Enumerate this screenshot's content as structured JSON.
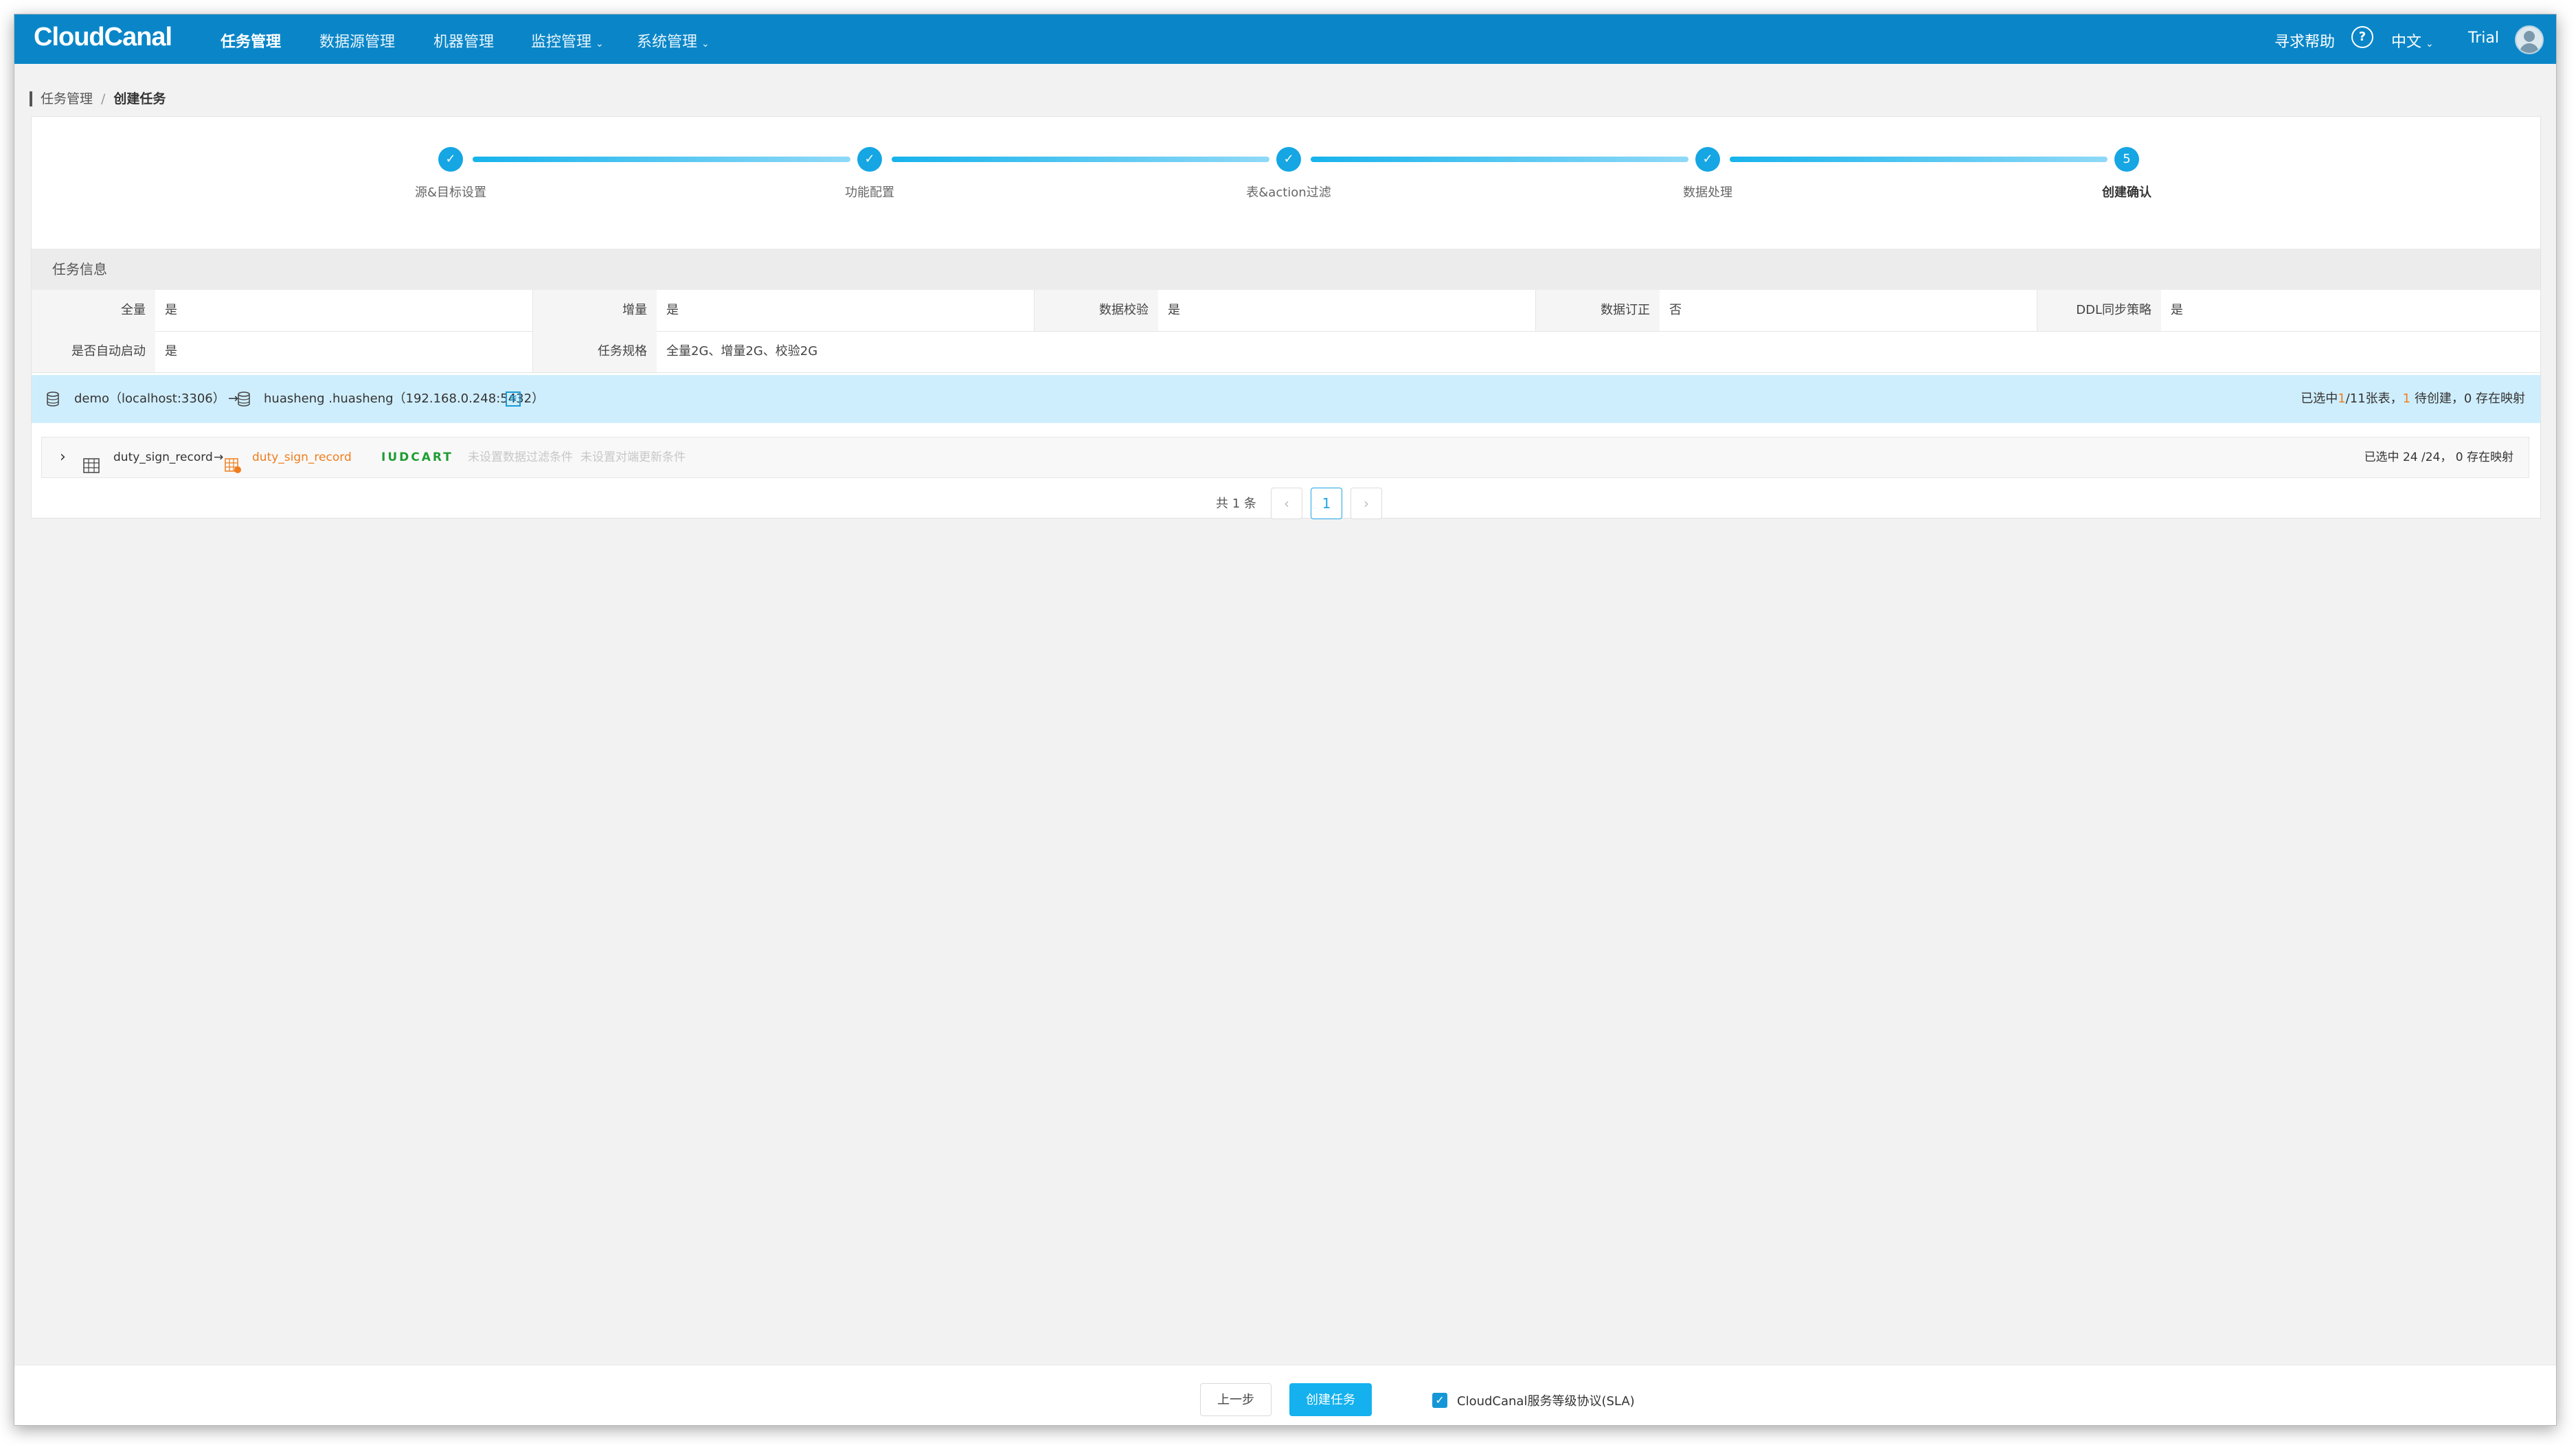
{
  "app": {
    "logo": "CloudCanal"
  },
  "nav": {
    "items": [
      "任务管理",
      "数据源管理",
      "机器管理",
      "监控管理",
      "系统管理"
    ],
    "help": "寻求帮助",
    "language": "中文",
    "user": "Trial"
  },
  "breadcrumb": {
    "parent": "任务管理",
    "separator": "/",
    "current": "创建任务"
  },
  "steps": [
    {
      "label": "源&目标设置",
      "status": "done",
      "icon": "check-icon"
    },
    {
      "label": "功能配置",
      "status": "done",
      "icon": "check-icon"
    },
    {
      "label": "表&action过滤",
      "status": "done",
      "icon": "check-icon"
    },
    {
      "label": "数据处理",
      "status": "done",
      "icon": "check-icon"
    },
    {
      "label": "创建确认",
      "status": "current",
      "number": "5"
    }
  ],
  "task_info": {
    "title": "任务信息",
    "row1": [
      {
        "label": "全量",
        "value": "是"
      },
      {
        "label": "增量",
        "value": "是"
      },
      {
        "label": "数据校验",
        "value": "是"
      },
      {
        "label": "数据订正",
        "value": "否"
      },
      {
        "label": "DDL同步策略",
        "value": "是"
      }
    ],
    "row2": [
      {
        "label": "是否自动启动",
        "value": "是"
      },
      {
        "label": "任务规格",
        "value": "全量2G、增量2G、校验2G"
      }
    ]
  },
  "mapping": {
    "source": "demo（localhost:3306）",
    "arrow": "→",
    "target": "huasheng .huasheng（192.168.0.248:5432）",
    "summary_prefix": "已选中",
    "summary_selected": "1",
    "summary_mid": "/11张表，",
    "summary_pending": "1",
    "summary_suffix": " 待创建，0 存在映射"
  },
  "table_row": {
    "expand": "›",
    "source_table": "duty_sign_record",
    "arrow": "→",
    "target_table": "duty_sign_record",
    "actions": "IUDCART",
    "filter_hint": "未设置数据过滤条件",
    "update_hint": "未设置对端更新条件",
    "summary": "已选中 24 /24， 0 存在映射"
  },
  "pagination": {
    "total": "共 1 条",
    "prev": "‹",
    "page": "1",
    "next": "›"
  },
  "footer": {
    "prev_label": "上一步",
    "create_label": "创建任务",
    "sla_checked": true,
    "sla_label": "CloudCanal服务等级协议(SLA)"
  },
  "colors": {
    "topbar": "#0a86c8",
    "accent": "#15a6e3",
    "mapping_bg": "#cfeefd",
    "orange": "#ef7d1c",
    "green": "#1f9d34"
  }
}
